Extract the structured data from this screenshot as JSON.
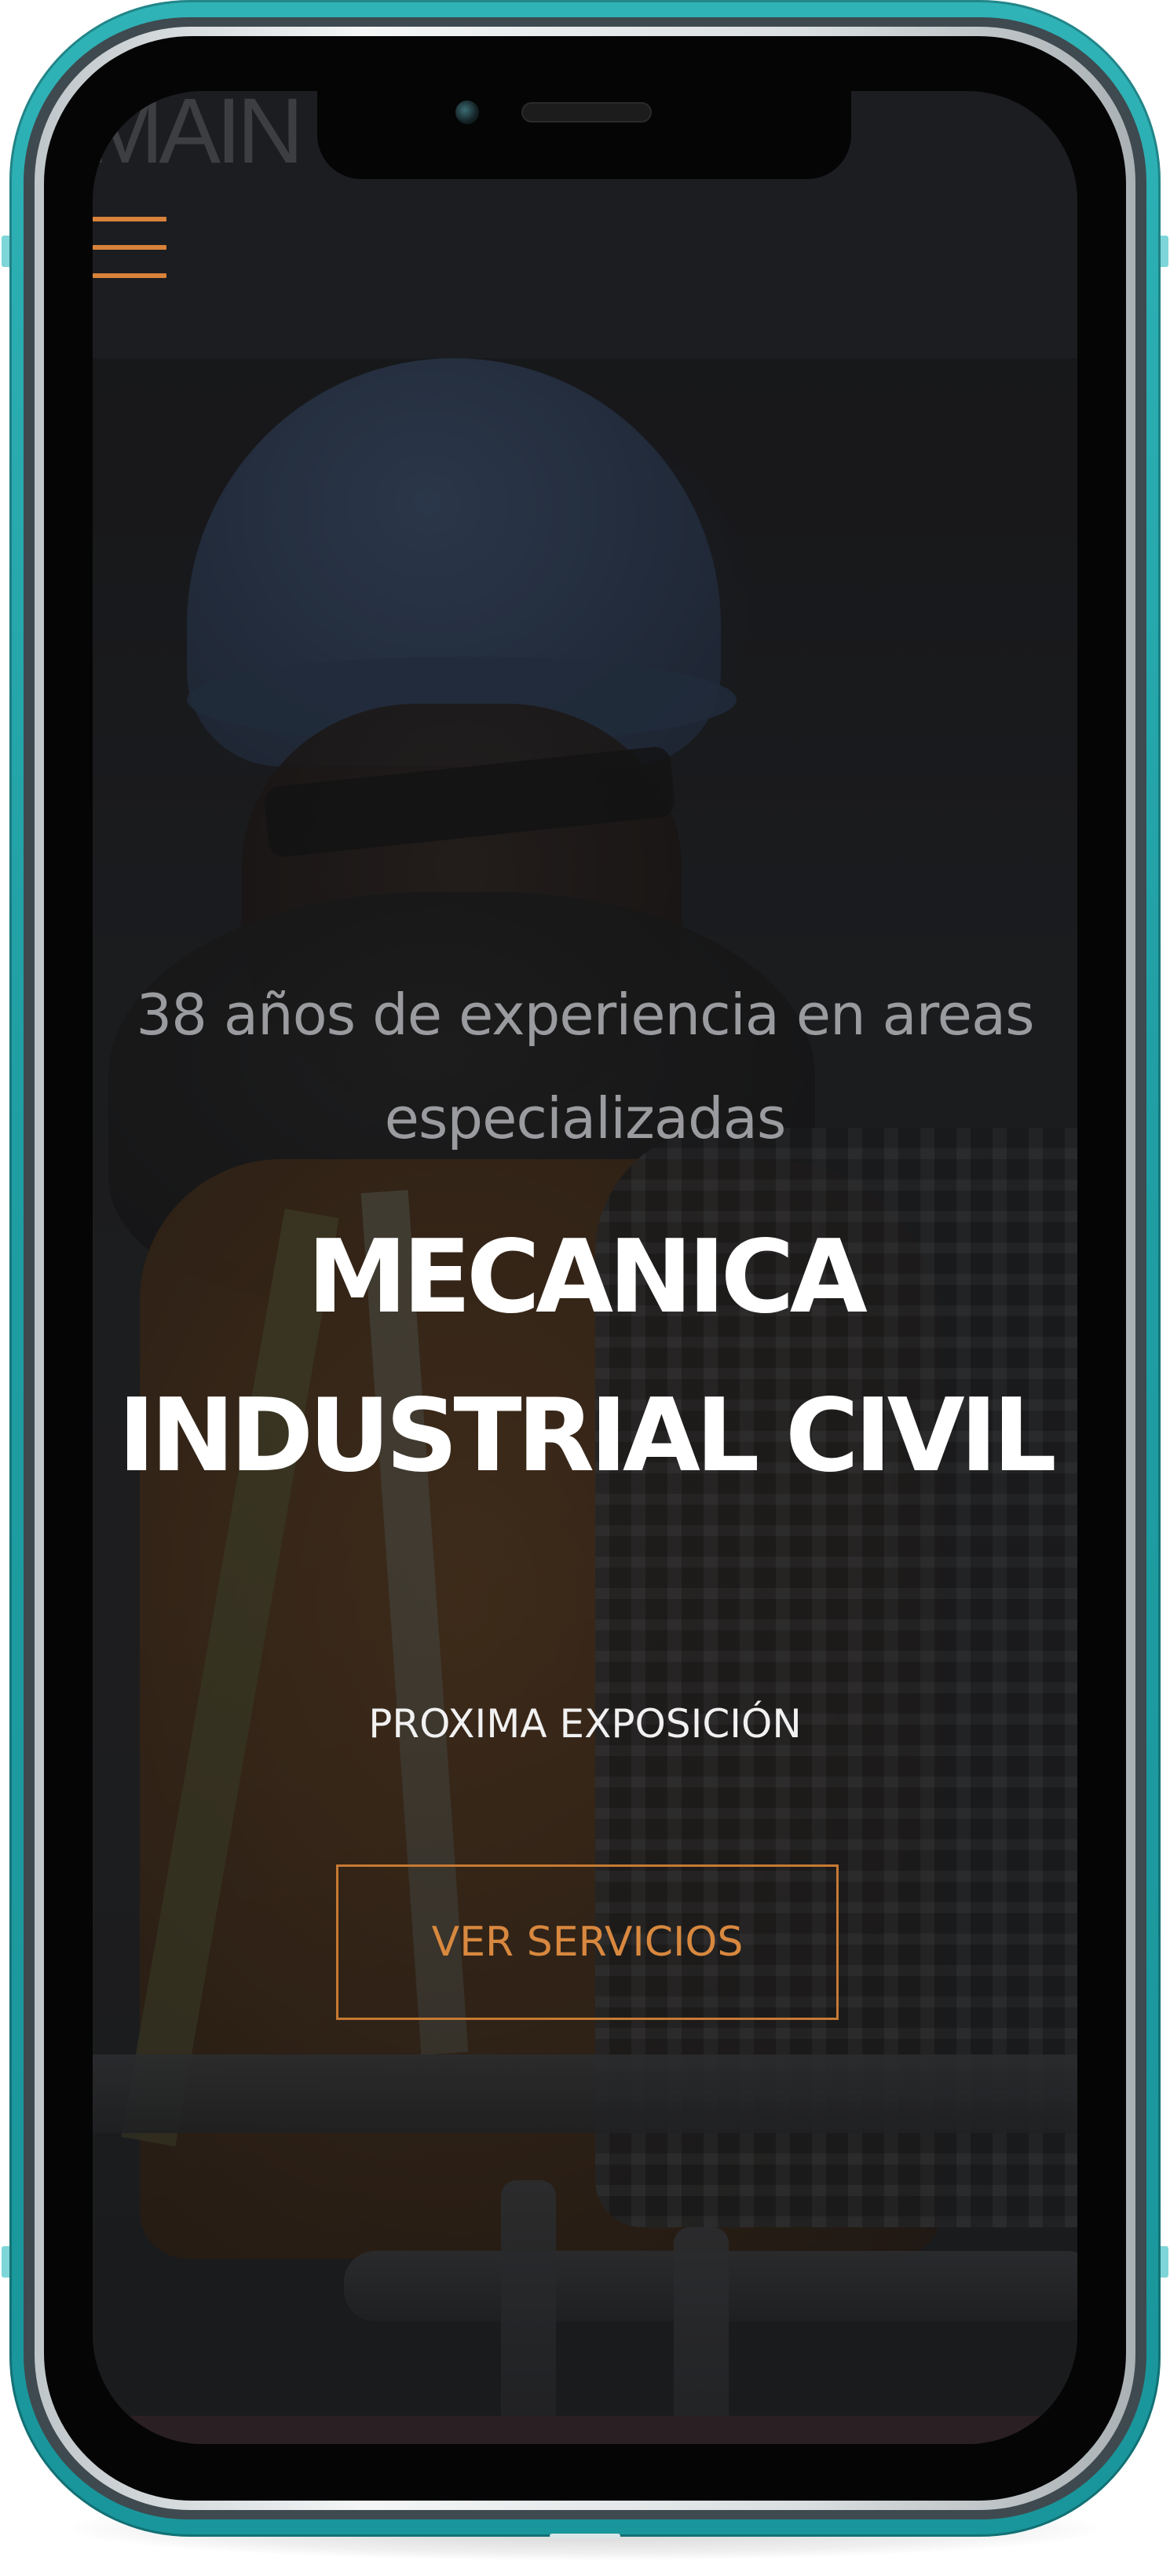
{
  "device": {
    "frame_color": "#1f9ea3",
    "accent_color": "#d8823a"
  },
  "header": {
    "logo_text": "MAIN",
    "menu_icon": "hamburger-menu-icon"
  },
  "hero": {
    "subtitle": "38 años de experiencia en areas especializadas",
    "title": "MECANICA\nINDUSTRIAL CIVIL",
    "eyebrow": "PROXIMA EXPOSICIÓN",
    "cta_label": "VER SERVICIOS"
  }
}
